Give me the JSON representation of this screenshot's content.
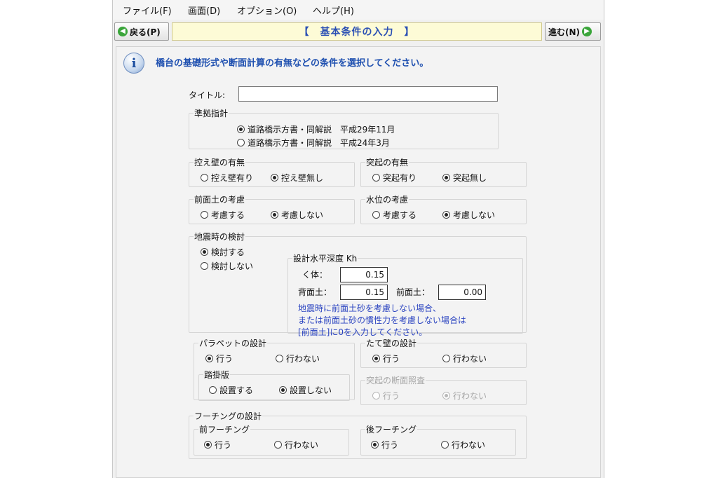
{
  "menu": [
    "ファイル(F)",
    "画面(D)",
    "オプション(O)",
    "ヘルプ(H)"
  ],
  "nav": {
    "back_label": "戻る(P)",
    "next_label": "進む(N)",
    "page_title": "【　基本条件の入力　】"
  },
  "info": {
    "icon": "info-icon",
    "text": "橋台の基礎形式や断面計算の有無などの条件を選択してください。"
  },
  "title_field": {
    "label": "タイトル:",
    "value": ""
  },
  "standard": {
    "legend": "準拠指針",
    "options": [
      "道路橋示方書・同解説　平成29年11月",
      "道路橋示方書・同解説　平成24年3月"
    ],
    "selected": 0
  },
  "retaining_wall": {
    "legend": "控え壁の有無",
    "options": [
      "控え壁有り",
      "控え壁無し"
    ],
    "selected": 1
  },
  "protrusion": {
    "legend": "突起の有無",
    "options": [
      "突起有り",
      "突起無し"
    ],
    "selected": 1
  },
  "front_soil": {
    "legend": "前面土の考慮",
    "options": [
      "考慮する",
      "考慮しない"
    ],
    "selected": 1
  },
  "water_level": {
    "legend": "水位の考慮",
    "options": [
      "考慮する",
      "考慮しない"
    ],
    "selected": 1
  },
  "seismic": {
    "legend": "地震時の検討",
    "options": [
      "検討する",
      "検討しない"
    ],
    "selected": 0,
    "kh": {
      "legend": "設計水平深度 Kh",
      "body_label": "く体：",
      "body_value": "0.15",
      "back_label": "背面土：",
      "back_value": "0.15",
      "front_label": "前面土：",
      "front_value": "0.00",
      "note": [
        "地震時に前面土砂を考慮しない場合、",
        "または前面土砂の慣性力を考慮しない場合は",
        "[前面土]に0を入力してください。"
      ]
    }
  },
  "parapet": {
    "legend": "パラペットの設計",
    "options": [
      "行う",
      "行わない"
    ],
    "selected": 0,
    "approach_slab": {
      "legend": "踏掛版",
      "options": [
        "設置する",
        "設置しない"
      ],
      "selected": 1
    }
  },
  "vertical_wall": {
    "legend": "たて壁の設計",
    "options": [
      "行う",
      "行わない"
    ],
    "selected": 0
  },
  "protrusion_section": {
    "legend": "突起の断面照査",
    "options": [
      "行う",
      "行わない"
    ],
    "selected": 1,
    "disabled": true
  },
  "footing": {
    "legend": "フーチングの設計",
    "front": {
      "legend": "前フーチング",
      "options": [
        "行う",
        "行わない"
      ],
      "selected": 0
    },
    "rear": {
      "legend": "後フーチング",
      "options": [
        "行う",
        "行わない"
      ],
      "selected": 0
    }
  }
}
